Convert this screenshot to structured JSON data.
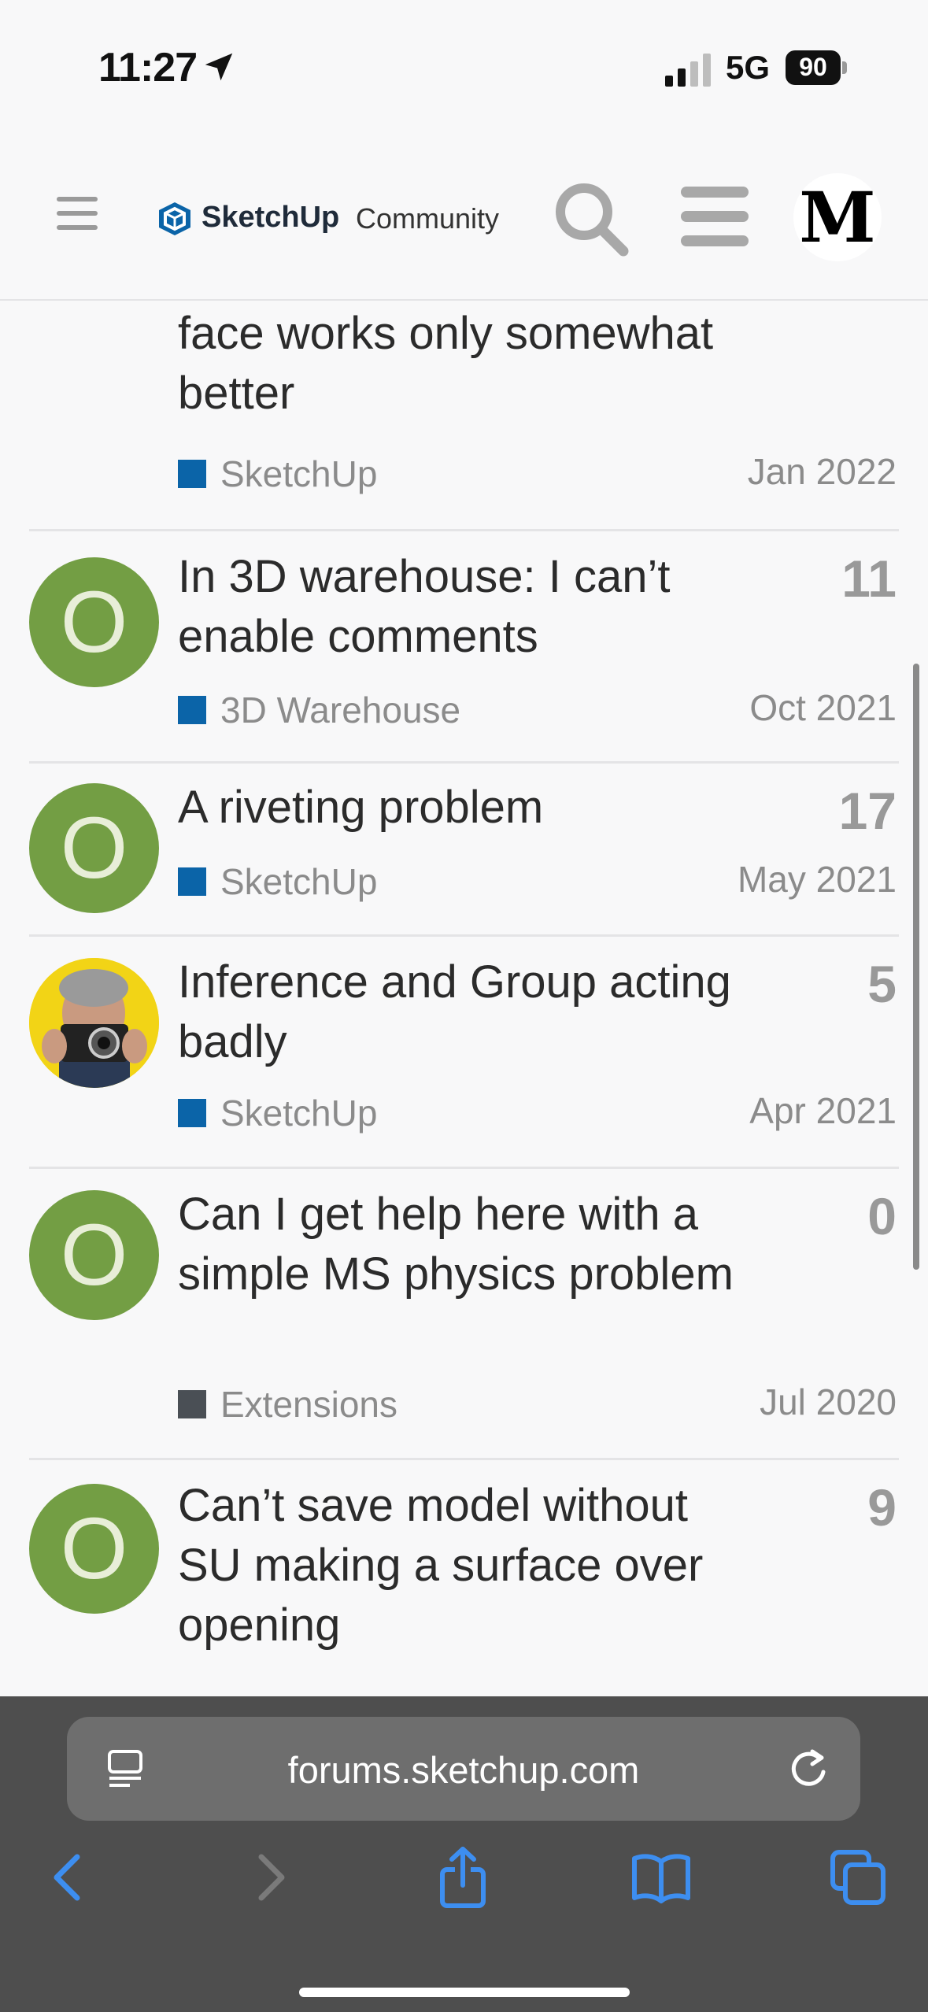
{
  "status_bar": {
    "time": "11:27",
    "network": "5G",
    "battery": "90"
  },
  "header": {
    "brand": "SketchUp",
    "section": "Community",
    "user_initial": "M"
  },
  "topics": [
    {
      "title": "concave surface, convex face works only somewhat better",
      "title_visible": "face works only somewhat better",
      "category": "SketchUp",
      "category_color": "#0b64a8",
      "date": "Jan 2022",
      "replies": ""
    },
    {
      "title": "In 3D warehouse: I can’t enable comments",
      "avatar_letter": "O",
      "category": "3D Warehouse",
      "category_color": "#0b64a8",
      "date": "Oct 2021",
      "replies": "11"
    },
    {
      "title": "A riveting problem",
      "avatar_letter": "O",
      "category": "SketchUp",
      "category_color": "#0b64a8",
      "date": "May 2021",
      "replies": "17"
    },
    {
      "title": "Inference and Group acting badly",
      "avatar": "photo-avatar",
      "category": "SketchUp",
      "category_color": "#0b64a8",
      "date": "Apr 2021",
      "replies": "5"
    },
    {
      "title": "Can I get help here with a simple MS physics problem",
      "avatar_letter": "O",
      "category": "Extensions",
      "category_color": "#4a4f55",
      "date": "Jul 2020",
      "replies": "0"
    },
    {
      "title": "Can’t save model without SU making a surface over opening",
      "avatar_letter": "O",
      "category": "",
      "date": "",
      "replies": "9"
    }
  ],
  "browser": {
    "url": "forums.sketchup.com"
  },
  "colors": {
    "avatar_green": "#739e44",
    "accent_blue": "#0b64a8",
    "safari_icon_blue": "#3d8ef0"
  }
}
